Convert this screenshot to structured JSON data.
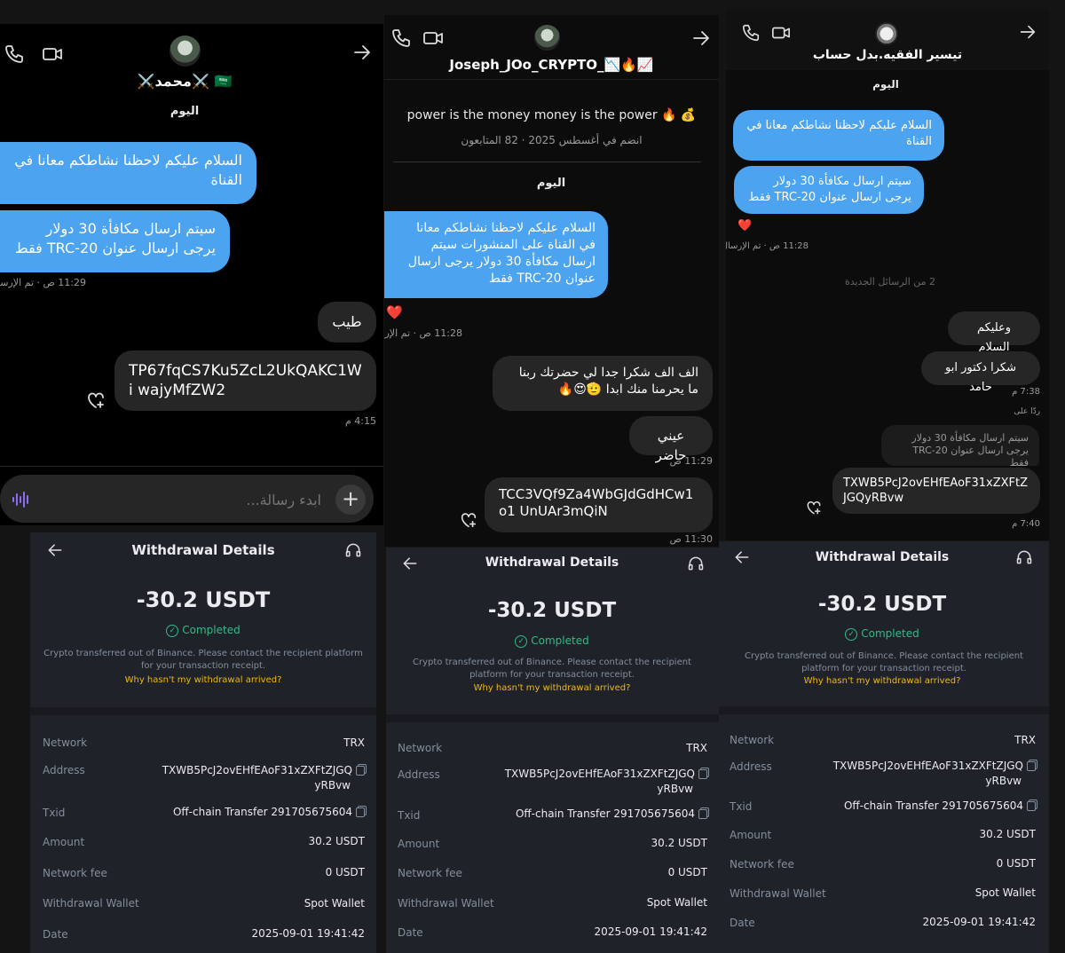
{
  "chat1": {
    "name": "⚔️محمد⚔️ 🇸🇦",
    "day": "اليوم",
    "msg1": "السلام عليكم لاحظنا نشاطكم معانا في القناة",
    "msg2": "سيتم ارسال مكافأة 30 دولار يرجى ارسال عنوان TRC-20 فقط",
    "sent_meta": "11:29 ص · تم الإرسال",
    "reply1": "طيب",
    "reply2": "TP67fqCS7Ku5ZcL2UkQAKC1Wi wajyMfZW2",
    "time2": "4:15 م",
    "input_placeholder": "ابدء رسالة..."
  },
  "chat2": {
    "name": "Joseph_JOo_CRYPTO_📉🔥📈",
    "bio": "power is the money money is the power 🔥 💰",
    "joined": "انضم في أغسطس 2025 · 82 المتابعون",
    "day": "اليوم",
    "msg1": "السلام عليكم لاحظنا نشاطكم معانا في القناة على المنشورات سيتم ارسال مكافأة 30 دولار يرجى ارسال عنوان TRC-20 فقط",
    "sent_meta": "11:28 ص · تم الإرسال",
    "reply1": "الف الف شكرا جدا لي حضرتك ربنا ما يحرمنا منك ابدا 🫡😍🔥",
    "reply2": "عيني حاضر",
    "time1": "11:29 ص",
    "reply3": "TCC3VQf9Za4WbGJdGdHCw1o1 UnUAr3mQiN",
    "time2": "11:30 ص"
  },
  "chat3": {
    "name": "تيسير الفقيه.بدل حساب",
    "day": "اليوم",
    "msg1": "السلام عليكم لاحظنا نشاطكم معانا في القناة",
    "msg2": "سيتم ارسال مكافأة 30 دولار يرجى ارسال عنوان TRC-20 فقط",
    "sent_meta": "11:28 ص · تم الإرسال",
    "new_msgs": "2 من الرسائل الجديدة",
    "reply1": "وعليكم السلام",
    "reply2": "شكرا دكتور ابو حامد",
    "time1": "7:38 م",
    "replied_to": "ردّا على",
    "quoted": "سيتم ارسال مكافأة 30 دولار يرجى ارسال عنوان TRC-20 فقط",
    "reply3": "TXWB5PcJ2ovEHfEAoF31xZXFtZ JGQyRBvw",
    "time2": "7:40 م"
  },
  "withdraw": {
    "title": "Withdrawal Details",
    "amount": "-30.2 USDT",
    "status": "Completed",
    "desc": "Crypto transferred out of Binance. Please contact the recipient platform for your transaction receipt.",
    "why": "Why hasn't my withdrawal arrived?",
    "labels": {
      "network": "Network",
      "address": "Address",
      "txid": "Txid",
      "amount": "Amount",
      "fee": "Network fee",
      "wallet": "Withdrawal Wallet",
      "date": "Date"
    },
    "network": "TRX",
    "address_line1": "TXWB5PcJ2ovEHfEAoF31xZXFtZJGQ",
    "address_line2": "yRBvw",
    "txid": "Off-chain Transfer 291705675604",
    "amount_value": "30.2 USDT",
    "fee": "0 USDT",
    "wallet": "Spot Wallet",
    "date": "2025-09-01 19:41:42"
  },
  "colors": {
    "accent_blue": "#4ca3f0",
    "binance_bg": "#1f2229",
    "completed_green": "#2ebd85",
    "link_yellow": "#f0b90b",
    "heart_red": "#e0264a"
  },
  "icons": [
    "phone-icon",
    "video-icon",
    "arrow-right-icon",
    "heart-plus-icon",
    "voice-icon",
    "plus-icon",
    "back-arrow-icon",
    "headset-icon",
    "check-circle-icon",
    "copy-icon"
  ]
}
